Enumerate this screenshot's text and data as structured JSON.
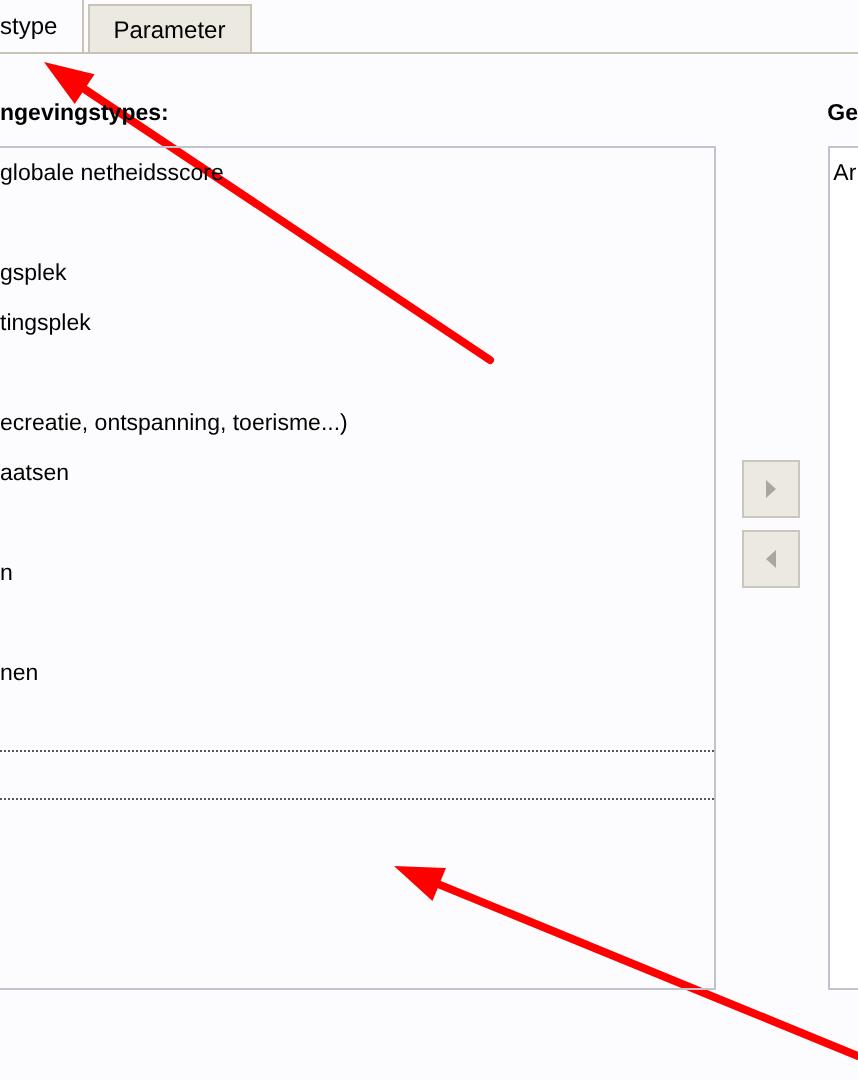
{
  "tabs": [
    {
      "label": "stype",
      "selected": true
    },
    {
      "label": "Parameter",
      "selected": false
    }
  ],
  "available": {
    "label": "ngevingstypes:",
    "rows": [
      {
        "text": "globale netheidsscore",
        "focused": false
      },
      {
        "focused": false
      },
      {
        "text": "gsplek",
        "focused": false
      },
      {
        "text": "tingsplek",
        "focused": false
      },
      {
        "focused": false
      },
      {
        "text": "ecreatie, ontspanning, toerisme...)",
        "focused": false
      },
      {
        "text": "aatsen",
        "focused": false
      },
      {
        "focused": false
      },
      {
        "text": "n",
        "focused": false
      },
      {
        "focused": false
      },
      {
        "text": "nen",
        "focused": false
      },
      {
        "focused": false
      },
      {
        "focused": true
      }
    ]
  },
  "move_buttons": [
    {
      "kind": "right",
      "disabled": true
    },
    {
      "kind": "left",
      "disabled": true
    }
  ],
  "chosen": {
    "label": "Ge",
    "rows": [
      {
        "text": "Ar"
      }
    ]
  },
  "annotations": [
    {
      "kind": "arrow"
    },
    {
      "kind": "arrow"
    }
  ]
}
